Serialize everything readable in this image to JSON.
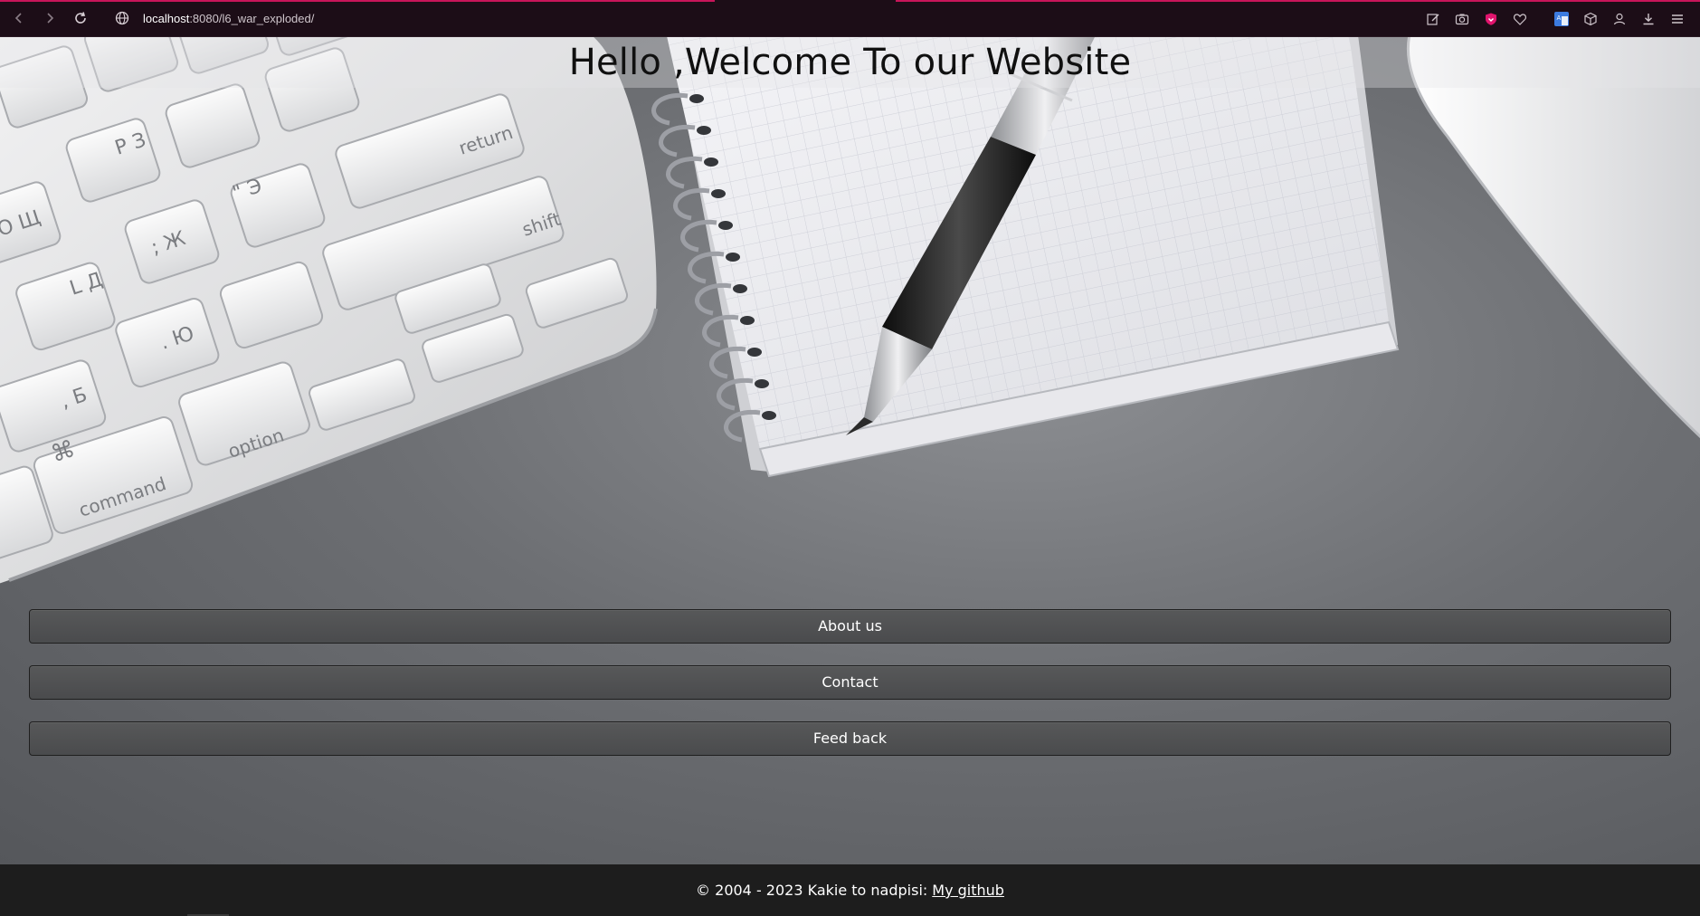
{
  "browser": {
    "url_host": "localhost",
    "url_rest": ":8080/l6_war_exploded/",
    "icons": [
      "back-icon",
      "forward-icon",
      "reload-icon",
      "globe-icon",
      "edit-icon",
      "camera-icon",
      "shield-icon",
      "heart-icon",
      "translate-icon",
      "cube-icon",
      "profile-icon",
      "download-icon",
      "menu-icon"
    ],
    "accent_color": "#c8155a"
  },
  "page": {
    "title": "Hello ,Welcome To our Website"
  },
  "menu": {
    "items": [
      {
        "label": "About us"
      },
      {
        "label": "Contact"
      },
      {
        "label": "Feed back"
      }
    ]
  },
  "footer": {
    "text": "© 2004 - 2023 Kakie to nadpisi:",
    "link_label": "My github"
  }
}
